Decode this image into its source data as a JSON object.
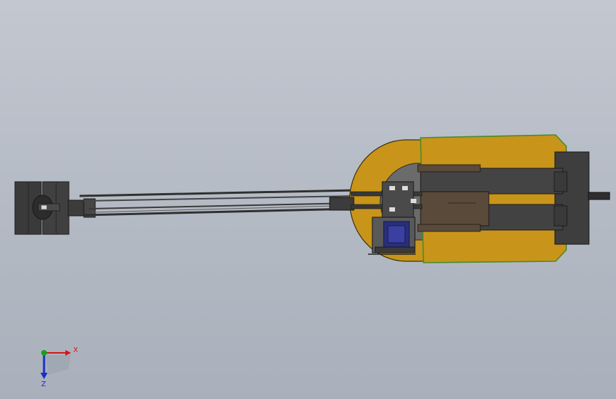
{
  "viewport": {
    "background_top": "#c3c8d0",
    "background_bottom": "#a9b0bb"
  },
  "model": {
    "body_color": "#c8951a",
    "body_outline": "#4a8a2a",
    "dark_part_color": "#3f3f3f",
    "brown_part_color": "#5a4a3a",
    "motor_color": "#2a2f7a",
    "track_color": "#3a3a3a"
  },
  "triad": {
    "x_label": "X",
    "z_label": "Z",
    "x_color": "#d01818",
    "y_color": "#18a018",
    "z_color": "#1830c8"
  }
}
